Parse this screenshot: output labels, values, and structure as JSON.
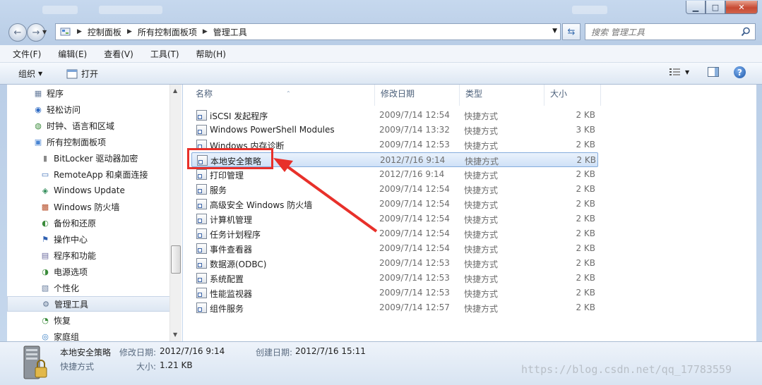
{
  "window": {
    "colors": {
      "accent": "#3a6fb7",
      "selection_border": "#84acdd",
      "highlight_red": "#e8302a"
    }
  },
  "address": {
    "crumbs": [
      "控制面板",
      "所有控制面板项",
      "管理工具"
    ]
  },
  "search": {
    "placeholder": "搜索 管理工具"
  },
  "menu": [
    "文件(F)",
    "编辑(E)",
    "查看(V)",
    "工具(T)",
    "帮助(H)"
  ],
  "toolbar": {
    "organize_label": "组织",
    "open_label": "打开"
  },
  "nav": {
    "items": [
      {
        "label": "程序",
        "icon": "programs-icon"
      },
      {
        "label": "轻松访问",
        "icon": "ease-of-access-icon"
      },
      {
        "label": "时钟、语言和区域",
        "icon": "clock-globe-icon"
      },
      {
        "label": "所有控制面板项",
        "icon": "control-panel-icon"
      },
      {
        "label": "BitLocker 驱动器加密",
        "icon": "bitlocker-icon"
      },
      {
        "label": "RemoteApp 和桌面连接",
        "icon": "remoteapp-icon"
      },
      {
        "label": "Windows Update",
        "icon": "windows-update-icon"
      },
      {
        "label": "Windows 防火墙",
        "icon": "firewall-icon"
      },
      {
        "label": "备份和还原",
        "icon": "backup-icon"
      },
      {
        "label": "操作中心",
        "icon": "action-center-flag-icon"
      },
      {
        "label": "程序和功能",
        "icon": "programs-features-icon"
      },
      {
        "label": "电源选项",
        "icon": "power-icon"
      },
      {
        "label": "个性化",
        "icon": "personalization-icon"
      },
      {
        "label": "管理工具",
        "icon": "admin-tools-icon",
        "selected": true
      },
      {
        "label": "恢复",
        "icon": "recovery-icon"
      },
      {
        "label": "家庭组",
        "icon": "homegroup-icon"
      }
    ]
  },
  "columns": {
    "name": "名称",
    "modified": "修改日期",
    "type": "类型",
    "size": "大小"
  },
  "files": [
    {
      "name": "iSCSI 发起程序",
      "modified": "2009/7/14 12:54",
      "type": "快捷方式",
      "size": "2 KB"
    },
    {
      "name": "Windows PowerShell Modules",
      "modified": "2009/7/14 13:32",
      "type": "快捷方式",
      "size": "3 KB"
    },
    {
      "name": "Windows 内存诊断",
      "modified": "2009/7/14 12:53",
      "type": "快捷方式",
      "size": "2 KB"
    },
    {
      "name": "本地安全策略",
      "modified": "2012/7/16 9:14",
      "type": "快捷方式",
      "size": "2 KB",
      "selected": true
    },
    {
      "name": "打印管理",
      "modified": "2012/7/16 9:14",
      "type": "快捷方式",
      "size": "2 KB"
    },
    {
      "name": "服务",
      "modified": "2009/7/14 12:54",
      "type": "快捷方式",
      "size": "2 KB"
    },
    {
      "name": "高级安全 Windows 防火墙",
      "modified": "2009/7/14 12:54",
      "type": "快捷方式",
      "size": "2 KB"
    },
    {
      "name": "计算机管理",
      "modified": "2009/7/14 12:54",
      "type": "快捷方式",
      "size": "2 KB"
    },
    {
      "name": "任务计划程序",
      "modified": "2009/7/14 12:54",
      "type": "快捷方式",
      "size": "2 KB"
    },
    {
      "name": "事件查看器",
      "modified": "2009/7/14 12:54",
      "type": "快捷方式",
      "size": "2 KB"
    },
    {
      "name": "数据源(ODBC)",
      "modified": "2009/7/14 12:53",
      "type": "快捷方式",
      "size": "2 KB"
    },
    {
      "name": "系统配置",
      "modified": "2009/7/14 12:53",
      "type": "快捷方式",
      "size": "2 KB"
    },
    {
      "name": "性能监视器",
      "modified": "2009/7/14 12:53",
      "type": "快捷方式",
      "size": "2 KB"
    },
    {
      "name": "组件服务",
      "modified": "2009/7/14 12:57",
      "type": "快捷方式",
      "size": "2 KB"
    }
  ],
  "details": {
    "name": "本地安全策略",
    "type": "快捷方式",
    "modified_label": "修改日期:",
    "modified_value": "2012/7/16 9:14",
    "size_label": "大小:",
    "size_value": "1.21 KB",
    "created_label": "创建日期:",
    "created_value": "2012/7/16 15:11"
  },
  "watermark": "https://blog.csdn.net/qq_17783559"
}
